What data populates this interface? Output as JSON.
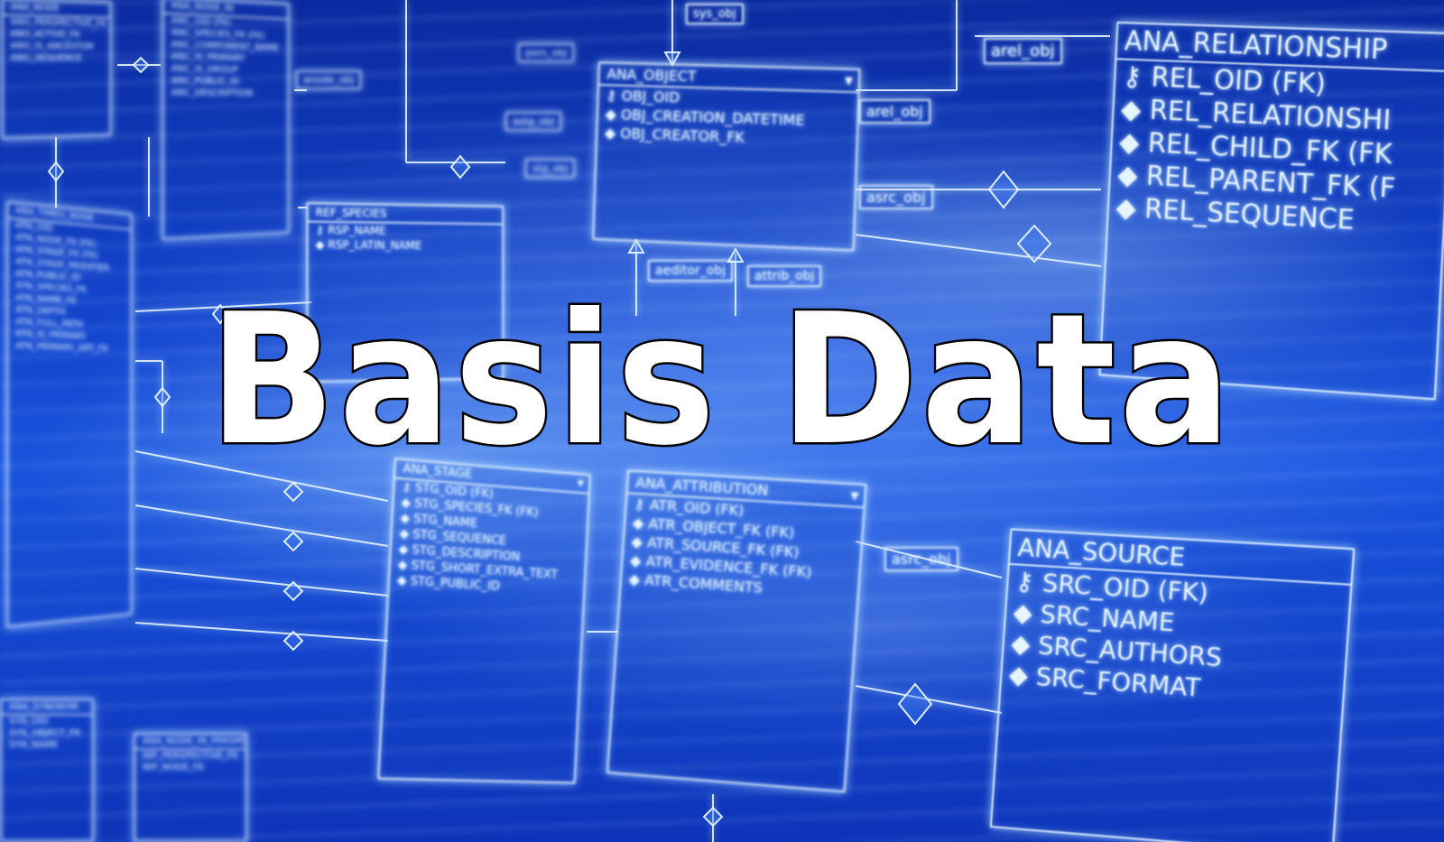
{
  "title": "Basis Data",
  "colors": {
    "background": "#1446d0",
    "line": "#e6f5ff",
    "title_fill": "#ffffff",
    "title_stroke": "#000000"
  },
  "tables": {
    "relationship": {
      "header": "ANA_RELATIONSHIP",
      "rows": [
        "REL_OID (FK)",
        "REL_RELATIONSHI",
        "REL_CHILD_FK (FK",
        "REL_PARENT_FK (F",
        "REL_SEQUENCE"
      ]
    },
    "object": {
      "header": "ANA_OBJECT",
      "rows": [
        "OBJ_OID",
        "OBJ_CREATION_DATETIME",
        "OBJ_CREATOR_FK"
      ]
    },
    "source": {
      "header": "ANA_SOURCE",
      "rows": [
        "SRC_OID (FK)",
        "SRC_NAME",
        "SRC_AUTHORS",
        "SRC_FORMAT"
      ]
    },
    "attribution": {
      "header": "ANA_ATTRIBUTION",
      "rows": [
        "ATR_OID (FK)",
        "ATR_OBJECT_FK (FK)",
        "ATR_SOURCE_FK (FK)",
        "ATR_EVIDENCE_FK (FK)",
        "ATR_COMMENTS"
      ]
    },
    "stage": {
      "header": "ANA_STAGE",
      "rows": [
        "STG_OID (FK)",
        "STG_SPECIES_FK (FK)",
        "STG_NAME",
        "STG_SEQUENCE",
        "STG_DESCRIPTION",
        "STG_SHORT_EXTRA_TEXT",
        "STG_PUBLIC_ID"
      ]
    },
    "species": {
      "header": "REF_SPECIES",
      "rows": [
        "RSP_NAME",
        "RSP_LATIN_NAME"
      ]
    },
    "left_far": {
      "header": "ANA_NODE_IN",
      "rows": [
        "ANC_OID (FK)",
        "ANC_SPECIES_FK (FK)",
        "ANC_COMPONENT_NAME",
        "ANC_IS_PRIMARY",
        "ANC_IS_GROUP",
        "ANC_PUBLIC_ID",
        "ANC_DESCRIPTION"
      ]
    },
    "left_mid": {
      "header": "ANA_TIMED_NODE",
      "rows": [
        "ATN_OID",
        "ATN_NODE_FK (FK)",
        "ATN_STAGE_FK (FK)",
        "ATN_STAGE_MODIFIER",
        "ATN_PUBLIC_ID",
        "ATN_SPECIES_FK",
        "ATN_NAME_FK",
        "ATN_DEPTH",
        "ATN_FULL_PATH",
        "ATN_IS_PRIMARY",
        "ATN_PRIMARY_ART_FK"
      ]
    },
    "top_left": {
      "header": "ANA_NODE",
      "rows": [
        "ANO_PERSPECTIVE_FK",
        "ANO_ACTIVE_FK",
        "ANO_IS_ANCESTOR",
        "ANO_SEQUENCE"
      ]
    }
  },
  "tags": {
    "sys_obj": "sys_obj",
    "rel_obj_top": "arel_obj",
    "rel_obj": "arel_obj",
    "src_obj": "asrc_obj",
    "src_obj_low": "asrc_obj",
    "editor_obj": "aeditor_obj",
    "attrib_obj": "attrib_obj",
    "pers_obj": "pers_obj",
    "stage_obj": "astg_obj",
    "node_obj": "anode_obj",
    "stg_obj": "stg_obj"
  }
}
